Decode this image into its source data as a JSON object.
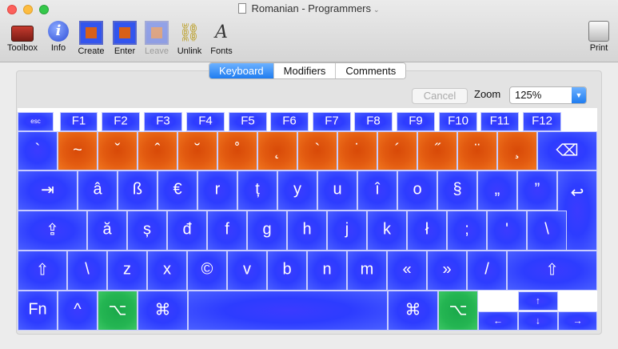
{
  "window": {
    "title": "Romanian - Programmers"
  },
  "toolbar": {
    "toolbox": "Toolbox",
    "info": "Info",
    "create": "Create",
    "enter": "Enter",
    "leave": "Leave",
    "unlink": "Unlink",
    "fonts": "Fonts",
    "print": "Print"
  },
  "tabs": {
    "keyboard": "Keyboard",
    "modifiers": "Modifiers",
    "comments": "Comments"
  },
  "controls": {
    "cancel": "Cancel",
    "zoom_label": "Zoom",
    "zoom_value": "125%"
  },
  "colors": {
    "normal": "#2d3cff",
    "dead": "#e25a10",
    "option": "#24b552",
    "tab_active": "#1f7cf0"
  },
  "keys": {
    "esc": "esc",
    "f1": "F1",
    "f2": "F2",
    "f3": "F3",
    "f4": "F4",
    "f5": "F5",
    "f6": "F6",
    "f7": "F7",
    "f8": "F8",
    "f9": "F9",
    "f10": "F10",
    "f11": "F11",
    "f12": "F12",
    "r1": [
      "`",
      "~",
      "ˇ",
      "ˆ",
      "˘",
      "˚",
      "˛",
      "`",
      "˙",
      "´",
      "˝",
      "¨",
      "¸"
    ],
    "delete": "⌫",
    "tab": "⇥",
    "r2": [
      "â",
      "ß",
      "€",
      "r",
      "ț",
      "y",
      "u",
      "î",
      "o",
      "§",
      "„",
      "”"
    ],
    "return": "↩",
    "caps": "⇪",
    "r3": [
      "ă",
      "ș",
      "đ",
      "f",
      "g",
      "h",
      "j",
      "k",
      "ł",
      ";",
      "'",
      "\\"
    ],
    "lshift": "⇧",
    "r4": [
      "\\",
      "z",
      "x",
      "©",
      "v",
      "b",
      "n",
      "m",
      "«",
      "»",
      "/"
    ],
    "rshift": "⇧",
    "fn": "Fn",
    "control": "^",
    "loption": "⌥",
    "lcommand": "⌘",
    "rcommand": "⌘",
    "roption": "⌥",
    "up": "↑",
    "left": "←",
    "down": "↓",
    "right": "→"
  }
}
